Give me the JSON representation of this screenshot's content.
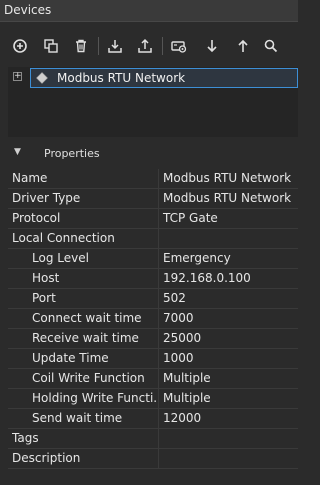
{
  "panel": {
    "title": "Devices"
  },
  "toolbar": {
    "buttons": [
      {
        "name": "add-icon"
      },
      {
        "name": "copy-icon"
      },
      {
        "name": "delete-icon"
      },
      {
        "name": "import-icon"
      },
      {
        "name": "export-icon"
      },
      {
        "name": "device-settings-icon"
      },
      {
        "name": "move-down-icon"
      },
      {
        "name": "move-up-icon"
      },
      {
        "name": "search-icon"
      }
    ]
  },
  "tree": {
    "expander": "+",
    "node_label": "Modbus RTU Network"
  },
  "properties": {
    "header": "Properties",
    "rows": [
      {
        "name": "Name",
        "value": "Modbus RTU Network"
      },
      {
        "name": "Driver Type",
        "value": "Modbus RTU Network"
      },
      {
        "name": "Protocol",
        "value": "TCP Gate"
      },
      {
        "name": "Local Connection",
        "value": ""
      },
      {
        "name": "Log Level",
        "value": "Emergency"
      },
      {
        "name": "Host",
        "value": "192.168.0.100"
      },
      {
        "name": "Port",
        "value": "502"
      },
      {
        "name": "Connect wait time",
        "value": "7000"
      },
      {
        "name": "Receive wait time",
        "value": "25000"
      },
      {
        "name": "Update Time",
        "value": "1000"
      },
      {
        "name": "Coil Write Function",
        "value": "Multiple"
      },
      {
        "name": "Holding Write Functi...",
        "value": "Multiple"
      },
      {
        "name": "Send wait time",
        "value": "12000"
      },
      {
        "name": "Tags",
        "value": ""
      },
      {
        "name": "Description",
        "value": ""
      }
    ]
  },
  "colors": {
    "background": "#2b2b2b",
    "title_bar": "#3a3a3a",
    "selection_border": "#3d8fd6",
    "text": "#e6e6e6"
  }
}
